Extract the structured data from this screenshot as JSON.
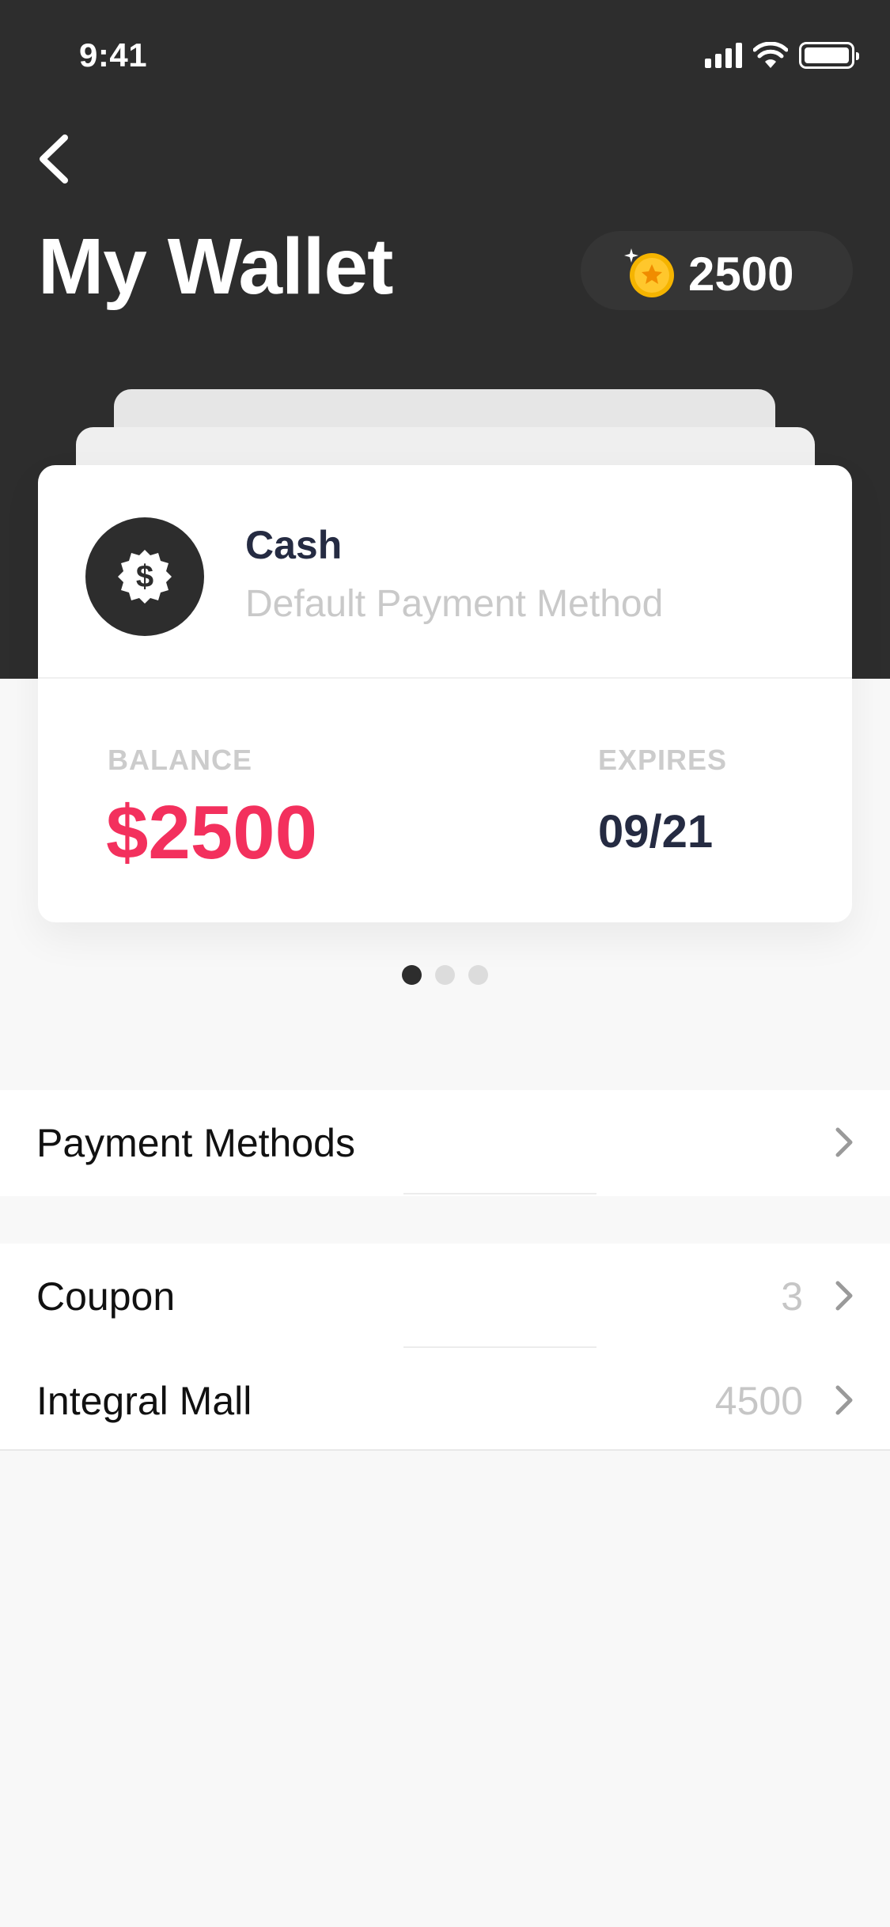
{
  "status_bar": {
    "time": "9:41"
  },
  "header": {
    "title": "My Wallet",
    "points": "2500"
  },
  "card": {
    "method_name": "Cash",
    "method_subtitle": "Default Payment Method",
    "balance_label": "BALANCE",
    "balance_value": "$2500",
    "expires_label": "EXPIRES",
    "expires_value": "09/21"
  },
  "pagination": {
    "total": 3,
    "active": 1
  },
  "list": {
    "payment_methods": {
      "label": "Payment Methods"
    },
    "coupon": {
      "label": "Coupon",
      "value": "3"
    },
    "integral_mall": {
      "label": "Integral Mall",
      "value": "4500"
    }
  },
  "colors": {
    "header_bg": "#2d2d2d",
    "balance_accent": "#f3305d",
    "coin": "#f5b400",
    "text_dark": "#252b42"
  },
  "icons": [
    "back-chevron-icon",
    "signal-icon",
    "wifi-icon",
    "battery-icon",
    "coin-star-icon",
    "dollar-badge-icon",
    "chevron-right-icon"
  ]
}
